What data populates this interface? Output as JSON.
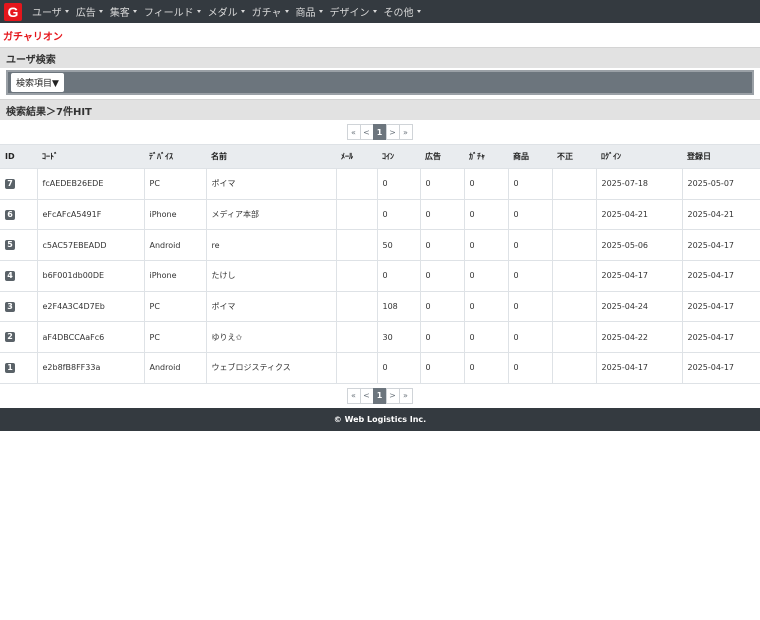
{
  "header": {
    "logo_letter": "G",
    "nav": [
      {
        "label": "ユーザ"
      },
      {
        "label": "広告"
      },
      {
        "label": "集客"
      },
      {
        "label": "フィールド"
      },
      {
        "label": "メダル"
      },
      {
        "label": "ガチャ"
      },
      {
        "label": "商品"
      },
      {
        "label": "デザイン"
      },
      {
        "label": "その他"
      }
    ]
  },
  "brand": "ガチャリオン",
  "search": {
    "title": "ユーザ検索",
    "toggle_label": "検索項目▼"
  },
  "results": {
    "title": "検索結果＞7件HIT"
  },
  "pager": {
    "first": "«",
    "prev": "<",
    "current": "1",
    "next": ">",
    "last": "»"
  },
  "table": {
    "columns": [
      "ID",
      "ｺｰﾄﾞ",
      "ﾃﾞﾊﾞｲｽ",
      "名前",
      "ﾒｰﾙ",
      "ｺｲﾝ",
      "広告",
      "ｶﾞﾁｬ",
      "商品",
      "不正",
      "ﾛｸﾞｲﾝ",
      "登録日"
    ],
    "rows": [
      {
        "id": "7",
        "code": "fcAEDEB26EDE",
        "device": "PC",
        "name": "ポイマ",
        "mail": "",
        "coin": "0",
        "ad": "0",
        "gacha": "0",
        "product": "0",
        "fraud": "",
        "login": "2025-07-18",
        "registered": "2025-05-07"
      },
      {
        "id": "6",
        "code": "eFcAFcA5491F",
        "device": "iPhone",
        "name": "メディア本部",
        "mail": "",
        "coin": "0",
        "ad": "0",
        "gacha": "0",
        "product": "0",
        "fraud": "",
        "login": "2025-04-21",
        "registered": "2025-04-21"
      },
      {
        "id": "5",
        "code": "c5AC57EBEADD",
        "device": "Android",
        "name": "re",
        "mail": "",
        "coin": "50",
        "ad": "0",
        "gacha": "0",
        "product": "0",
        "fraud": "",
        "login": "2025-05-06",
        "registered": "2025-04-17"
      },
      {
        "id": "4",
        "code": "b6F001db00DE",
        "device": "iPhone",
        "name": "たけし",
        "mail": "",
        "coin": "0",
        "ad": "0",
        "gacha": "0",
        "product": "0",
        "fraud": "",
        "login": "2025-04-17",
        "registered": "2025-04-17"
      },
      {
        "id": "3",
        "code": "e2F4A3C4D7Eb",
        "device": "PC",
        "name": "ポイマ",
        "mail": "",
        "coin": "108",
        "ad": "0",
        "gacha": "0",
        "product": "0",
        "fraud": "",
        "login": "2025-04-24",
        "registered": "2025-04-17"
      },
      {
        "id": "2",
        "code": "aF4DBCCAaFc6",
        "device": "PC",
        "name": "ゆりえ✩",
        "mail": "",
        "coin": "30",
        "ad": "0",
        "gacha": "0",
        "product": "0",
        "fraud": "",
        "login": "2025-04-22",
        "registered": "2025-04-17"
      },
      {
        "id": "1",
        "code": "e2b8fB8FF33a",
        "device": "Android",
        "name": "ウェブロジスティクス",
        "mail": "",
        "coin": "0",
        "ad": "0",
        "gacha": "0",
        "product": "0",
        "fraud": "",
        "login": "2025-04-17",
        "registered": "2025-04-17"
      }
    ]
  },
  "footer": {
    "text": "© Web Logistics Inc."
  },
  "colors": {
    "brand_red": "#e5161c",
    "navbar": "#343a40",
    "search_panel": "#6c757d"
  }
}
